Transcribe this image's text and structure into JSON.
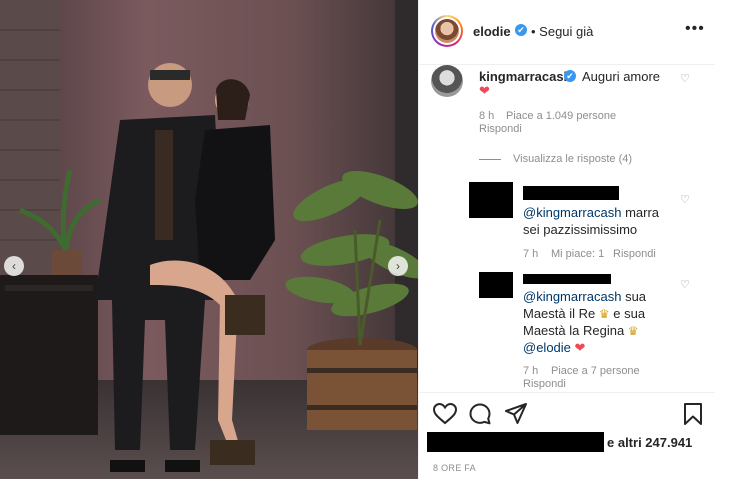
{
  "post_author": {
    "username": "elodie",
    "follow_status": "Segui già"
  },
  "comments": [
    {
      "username": "kingmarracash",
      "text": "Auguri amore",
      "time": "8 h",
      "likes": "Piace a 1.049 persone",
      "reply": "Rispondi",
      "view_replies": "Visualizza le risposte (4)"
    },
    {
      "mention": "@kingmarracash",
      "text_a": " marra",
      "text_b": "sei pazzissimissimo",
      "time": "7 h",
      "likes": "Mi piace: 1",
      "reply": "Rispondi"
    },
    {
      "mention": "@kingmarracash",
      "text_a": " sua",
      "text_b": "Maestà il Re ",
      "text_c": " e sua",
      "text_d": "Maestà la Regina ",
      "mention2": "@elodie",
      "time": "7 h",
      "likes": "Piace a 7 persone",
      "reply": "Rispondi"
    }
  ],
  "likes_summary": "e altri 247.941",
  "post_time": "8 ORE FA",
  "icons": {
    "verified": "✔",
    "more": "•••",
    "comment_like": "♡",
    "red_heart": "❤",
    "crown": "♛",
    "left": "‹",
    "right": "›"
  },
  "colors": {
    "accent_blue": "#3897f0",
    "mention": "#00376b",
    "heart_red": "#ed4956",
    "muted": "#8e8e8e"
  }
}
